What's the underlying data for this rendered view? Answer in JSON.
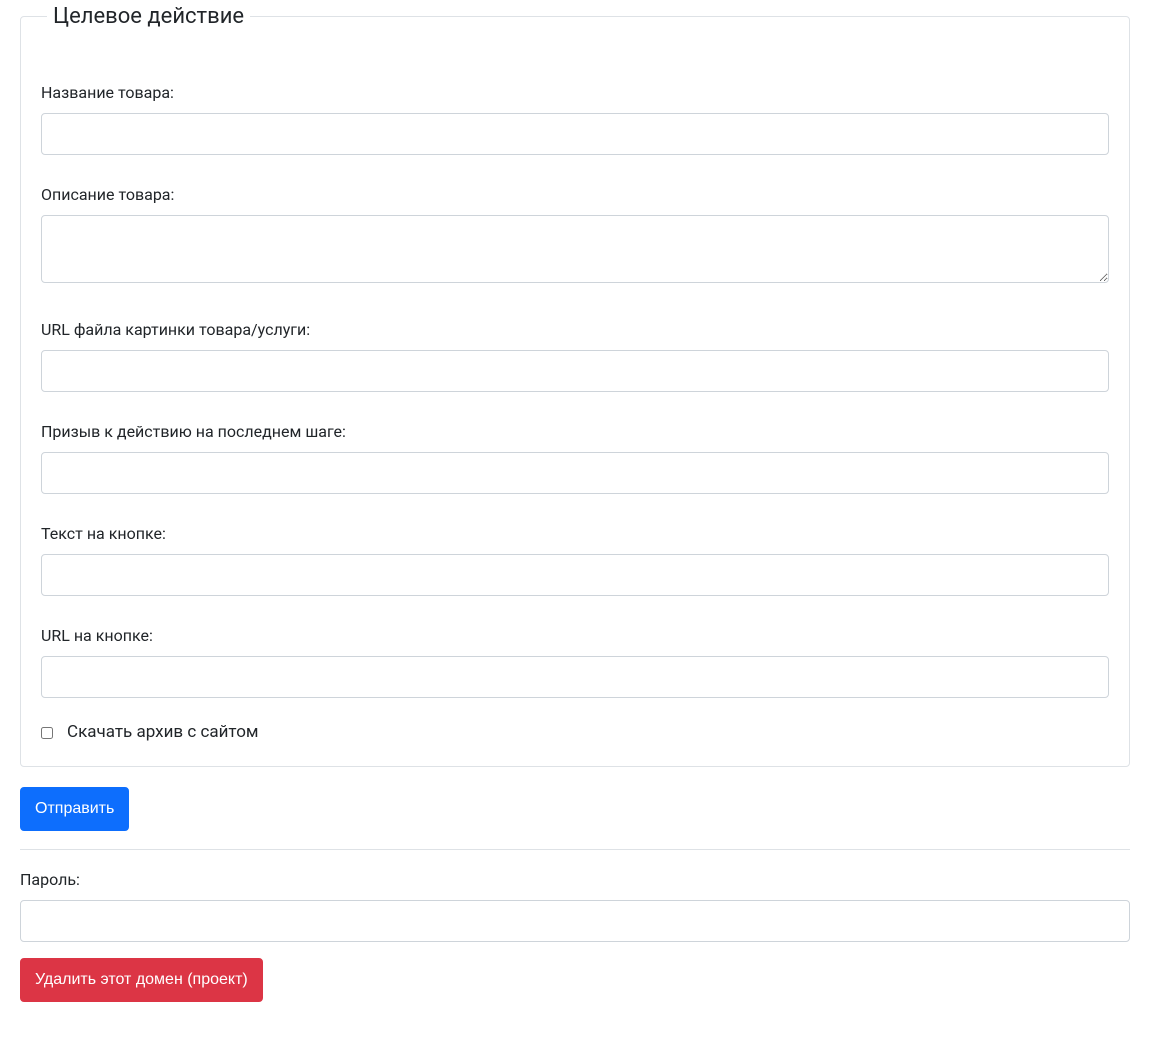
{
  "fieldset": {
    "legend": "Целевое действие",
    "fields": {
      "product_name": {
        "label": "Название товара:",
        "value": ""
      },
      "product_description": {
        "label": "Описание товара:",
        "value": ""
      },
      "image_url": {
        "label": "URL файла картинки товара/услуги:",
        "value": ""
      },
      "cta_last_step": {
        "label": "Призыв к действию на последнем шаге:",
        "value": ""
      },
      "button_text": {
        "label": "Текст на кнопке:",
        "value": ""
      },
      "button_url": {
        "label": "URL на кнопке:",
        "value": ""
      },
      "download_archive": {
        "label": "Скачать архив с сайтом",
        "checked": false
      }
    }
  },
  "submit_button": "Отправить",
  "password": {
    "label": "Пароль:",
    "value": ""
  },
  "delete_button": "Удалить этот домен (проект)"
}
